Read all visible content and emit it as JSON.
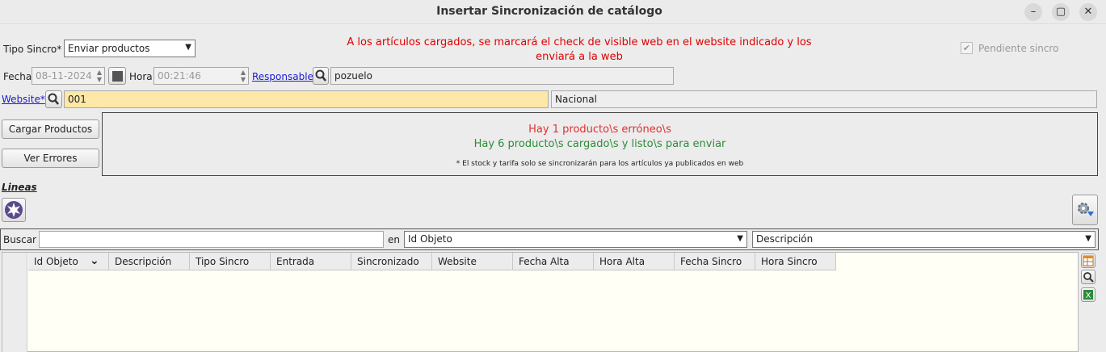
{
  "window": {
    "title": "Insertar Sincronización de catálogo",
    "controls": [
      "minimize-icon",
      "maximize-icon",
      "close-icon"
    ]
  },
  "header": {
    "tipo_sincro_label": "Tipo Sincro*",
    "tipo_sincro_value": "Enviar productos",
    "message_line1": "A los artículos cargados, se marcará el check de visible web en el website indicado y los",
    "message_line2": "enviará a la web",
    "pendiente_label": "Pendiente sincro",
    "pendiente_checked": true,
    "fecha_label": "Fecha",
    "fecha_value": "08-11-2024",
    "hora_label": "Hora",
    "hora_value": "00:21:46",
    "responsable_label": "Responsable",
    "responsable_value": "pozuelo",
    "website_label": "Website*",
    "website_value": "001",
    "website_name": "Nacional"
  },
  "actions": {
    "cargar": "Cargar Productos",
    "errores": "Ver Errores"
  },
  "status": {
    "error_text": "Hay 1 producto\\s erróneo\\s",
    "ok_text": "Hay 6 producto\\s cargado\\s y listo\\s para enviar",
    "note": "* El stock y tarifa solo se sincronizarán para los artículos ya publicados en web",
    "error_color": "#e03030",
    "ok_color": "#2e8b3a"
  },
  "lines": {
    "section_label": "Lineas",
    "buscar_label": "Buscar",
    "buscar_value": "",
    "en_label": "en",
    "search_field": "Id Objeto",
    "order_field": "Descripción",
    "columns": [
      "Id Objeto",
      "Descripción",
      "Tipo Sincro",
      "Entrada",
      "Sincronizado",
      "Website",
      "Fecha Alta",
      "Hora Alta",
      "Fecha Sincro",
      "Hora Sincro"
    ],
    "rows": []
  }
}
